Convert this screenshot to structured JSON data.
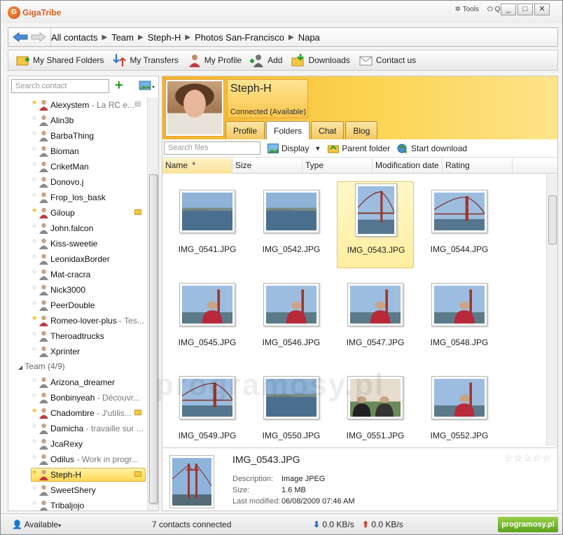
{
  "app": {
    "logo_text": "GigaTribe",
    "tools_label": "Tools",
    "quit_label": "Quit"
  },
  "breadcrumb": [
    "All contacts",
    "Team",
    "Steph-H",
    "Photos San-Francisco",
    "Napa"
  ],
  "toolbar": {
    "shared": "My Shared Folders",
    "transfers": "My Transfers",
    "profile": "My Profile",
    "add": "Add",
    "downloads": "Downloads",
    "contact": "Contact us"
  },
  "sidebar": {
    "search_placeholder": "Search contact",
    "contacts": [
      {
        "name": "Alexystem",
        "status": " - La RC e...",
        "star": true,
        "folder": false
      },
      {
        "name": "Alin3b",
        "status": "",
        "star": false,
        "folder": false
      },
      {
        "name": "BarbaThing",
        "status": "",
        "star": false,
        "folder": false
      },
      {
        "name": "Bioman",
        "status": "",
        "star": false,
        "folder": false
      },
      {
        "name": "CriketMan",
        "status": "",
        "star": false,
        "folder": false
      },
      {
        "name": "Donovo.j",
        "status": "",
        "star": false,
        "folder": false
      },
      {
        "name": "Frop_los_bask",
        "status": "",
        "star": false,
        "folder": false
      },
      {
        "name": "Giloup",
        "status": "",
        "star": true,
        "folder": true
      },
      {
        "name": "John.falcon",
        "status": "",
        "star": false,
        "folder": false
      },
      {
        "name": "Kiss-sweetie",
        "status": "",
        "star": false,
        "folder": false
      },
      {
        "name": "LeonidaxBorder",
        "status": "",
        "star": false,
        "folder": false
      },
      {
        "name": "Mat-cracra",
        "status": "",
        "star": false,
        "folder": false
      },
      {
        "name": "Nick3000",
        "status": "",
        "star": false,
        "folder": false
      },
      {
        "name": "PeerDouble",
        "status": "",
        "star": false,
        "folder": false
      },
      {
        "name": "Romeo-lover-plus",
        "status": " - Tes...",
        "star": true,
        "folder": false
      },
      {
        "name": "Theroadtrucks",
        "status": "",
        "star": false,
        "folder": false
      },
      {
        "name": "Xprinter",
        "status": "",
        "star": false,
        "folder": false
      }
    ],
    "group_label": "Team (4/9)",
    "team": [
      {
        "name": "Arizona_dreamer",
        "status": "",
        "star": false,
        "folder": false
      },
      {
        "name": "Bonbinyeah",
        "status": " - Découvr...",
        "star": false,
        "folder": false
      },
      {
        "name": "Chadombre",
        "status": " - J'utilis...",
        "star": true,
        "folder": true
      },
      {
        "name": "Damicha",
        "status": " - travaille sur ...",
        "star": false,
        "folder": false
      },
      {
        "name": "JcaRexy",
        "status": "",
        "star": false,
        "folder": false
      },
      {
        "name": "Odilus",
        "status": " - Work in progr...",
        "star": false,
        "folder": false
      },
      {
        "name": "Steph-H",
        "status": "",
        "star": true,
        "folder": true,
        "selected": true
      },
      {
        "name": "SweetShery",
        "status": "",
        "star": false,
        "folder": false
      },
      {
        "name": "Tribaljojo",
        "status": "",
        "star": false,
        "folder": false
      }
    ]
  },
  "profile": {
    "name": "Steph-H",
    "status": "Connected (Available)"
  },
  "tabs": [
    "Profile",
    "Folders",
    "Chat",
    "Blog"
  ],
  "filebar": {
    "search_placeholder": "Search files",
    "display": "Display",
    "parent": "Parent folder",
    "start": "Start download"
  },
  "columns": [
    "Name",
    "Size",
    "Type",
    "Modification date",
    "Rating"
  ],
  "files": [
    {
      "name": "IMG_0541.JPG",
      "kind": "bay"
    },
    {
      "name": "IMG_0542.JPG",
      "kind": "bay"
    },
    {
      "name": "IMG_0543.JPG",
      "kind": "bridge",
      "selected": true
    },
    {
      "name": "IMG_0544.JPG",
      "kind": "bridge"
    },
    {
      "name": "IMG_0545.JPG",
      "kind": "person"
    },
    {
      "name": "IMG_0546.JPG",
      "kind": "person"
    },
    {
      "name": "IMG_0547.JPG",
      "kind": "person"
    },
    {
      "name": "IMG_0548.JPG",
      "kind": "person"
    },
    {
      "name": "IMG_0549.JPG",
      "kind": "bridge"
    },
    {
      "name": "IMG_0550.JPG",
      "kind": "bay"
    },
    {
      "name": "IMG_0551.JPG",
      "kind": "group"
    },
    {
      "name": "IMG_0552.JPG",
      "kind": "person"
    }
  ],
  "details": {
    "title": "IMG_0543.JPG",
    "desc_label": "Description:",
    "desc": "Image JPEG",
    "size_label": "Size:",
    "size": "1.6 MB",
    "mod_label": "Last modified:",
    "mod": "06/08/2009 07:46 AM",
    "rating": 0
  },
  "watermark": "programosy.pl",
  "status": {
    "availability": "Available",
    "connected": "7 contacts connected",
    "down": "0.0 KB/s",
    "up": "0.0 KB/s",
    "badge": "programosy.pl"
  }
}
